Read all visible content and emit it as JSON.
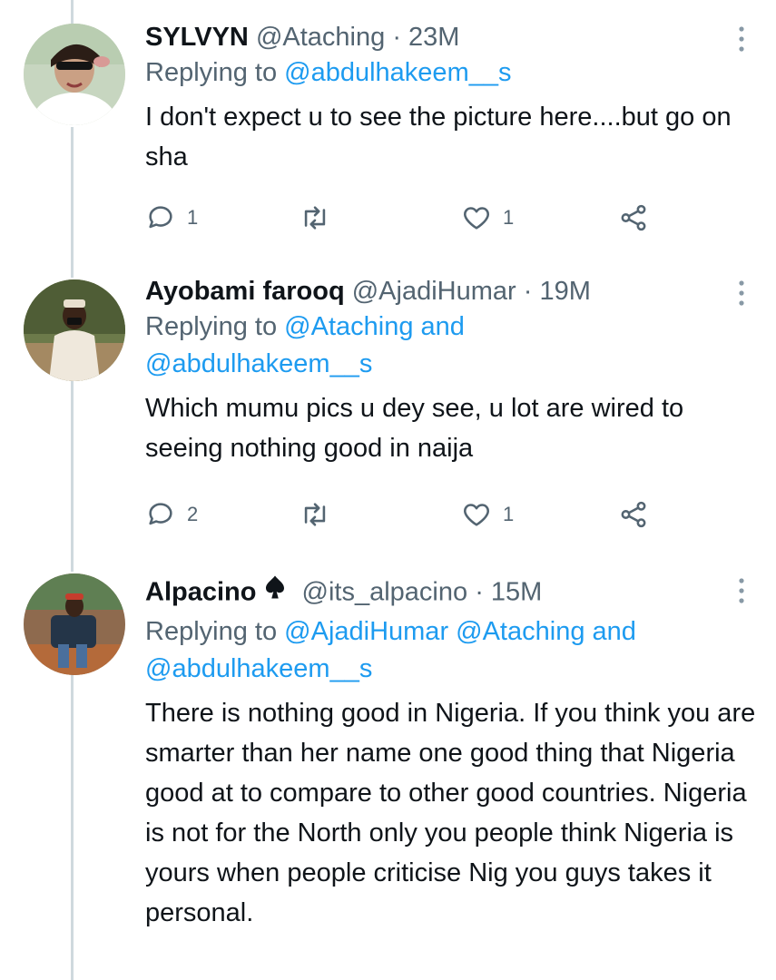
{
  "colors": {
    "text": "#0f1419",
    "secondary": "#536471",
    "link": "#1d9bf0",
    "thread_line": "#cfd9de"
  },
  "tweets": [
    {
      "display_name": "SYLVYN",
      "handle": "@Ataching",
      "time": "· 23M",
      "replying_prefix": "Replying to",
      "replying_to": "@abdulhakeem__s",
      "replying_and": "",
      "replying_to_2": "",
      "text": "I don't expect u to see the picture here....but go on sha",
      "reply_count": "1",
      "retweet_count": "",
      "like_count": "1",
      "avatar_icon": "profile-photo"
    },
    {
      "display_name": "Ayobami farooq",
      "handle": "@AjadiHumar",
      "time": "· 19M",
      "replying_prefix": "Replying to",
      "replying_to": "@Ataching",
      "replying_and": "and",
      "replying_to_2": "@abdulhakeem__s",
      "text": "Which mumu pics u dey see, u lot are wired to seeing nothing good in naija",
      "reply_count": "2",
      "retweet_count": "",
      "like_count": "1",
      "avatar_icon": "profile-photo"
    },
    {
      "display_name": "Alpacino",
      "name_badge_icon": "spade-icon",
      "handle": "@its_alpacino",
      "time": "· 15M",
      "replying_prefix": "Replying to",
      "replying_to": "@AjadiHumar @Ataching",
      "replying_and": "and",
      "replying_to_2": "@abdulhakeem__s",
      "text": "There is nothing good in Nigeria. If you think you are smarter than her name one good thing that Nigeria good at to compare to other good countries. Nigeria is not for the North only you people think Nigeria is yours when people criticise Nig you guys takes it personal.",
      "avatar_icon": "profile-photo"
    }
  ],
  "icons": {
    "reply": "reply-icon",
    "retweet": "retweet-icon",
    "like": "heart-icon",
    "share": "share-icon",
    "more": "more-vertical-icon"
  }
}
